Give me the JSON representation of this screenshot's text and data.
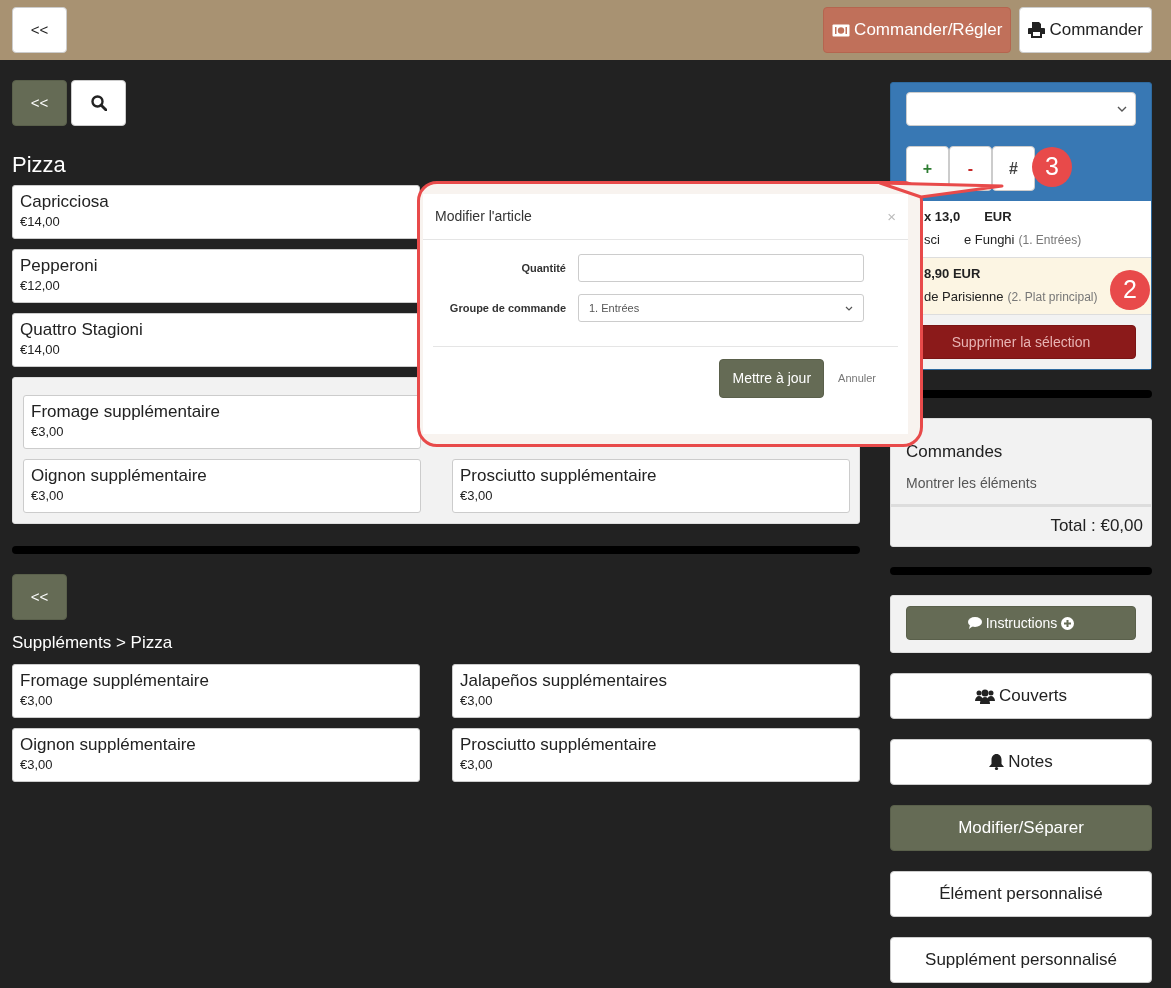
{
  "top_bar": {
    "back_button": "<<",
    "actions": [
      {
        "label": "Commander/Régler",
        "kind": "pay"
      },
      {
        "label": "Commander",
        "kind": "print"
      }
    ]
  },
  "menu": {
    "back_button": "<<",
    "section_title": "Pizza",
    "products": [
      {
        "name": "Capricciosa",
        "price": "€14,00"
      },
      {
        "name": "Pepperoni",
        "price": "€12,00"
      },
      {
        "name": "Quattro Stagioni",
        "price": "€14,00"
      }
    ],
    "supplement_columns": [
      [
        {
          "name": "Fromage supplémentaire",
          "price": "€3,00"
        },
        {
          "name": "Oignon supplémentaire",
          "price": "€3,00"
        }
      ],
      [
        {
          "name": "Prosciutto supplémentaire",
          "price": "€3,00"
        }
      ]
    ]
  },
  "supplements": {
    "back_button": "<<",
    "breadcrumb": "Suppléments > Pizza",
    "items": [
      {
        "name": "Fromage supplémentaire",
        "price": "€3,00"
      },
      {
        "name": "Jalapeños supplémentaires",
        "price": "€3,00"
      },
      {
        "name": "Oignon supplémentaire",
        "price": "€3,00"
      },
      {
        "name": "Prosciutto supplémentaire",
        "price": "€3,00"
      }
    ]
  },
  "order_panel": {
    "quantity_buttons": [
      {
        "label": "+",
        "kind": "plus"
      },
      {
        "label": "-",
        "kind": "minus"
      },
      {
        "label": "#",
        "kind": "hash"
      }
    ],
    "lines": [
      {
        "price_parts": [
          "x 13,0",
          "EUR"
        ],
        "name_parts": [
          "sci",
          "e Funghi"
        ],
        "group": "(1. Entrées)",
        "selected": false
      },
      {
        "price_parts": [
          "8,90 EUR"
        ],
        "name_parts": [
          "de Parisienne"
        ],
        "group": "(2. Plat principal)",
        "selected": true
      }
    ],
    "delete_button": {
      "label": "Supprimer la sélection",
      "disabled": true
    }
  },
  "orders_card": {
    "title": "Commandes",
    "link": "Montrer les éléments",
    "total": "Total : €0,00"
  },
  "instructions_button": "Instructions",
  "side_actions": [
    {
      "label": "Couverts",
      "kind": "covers"
    },
    {
      "label": "Notes",
      "kind": "notes"
    },
    {
      "label": "Modifier/Séparer",
      "kind": "split"
    },
    {
      "label": "Élément personnalisé",
      "kind": "plain"
    },
    {
      "label": "Supplément personnalisé",
      "kind": "plain"
    }
  ],
  "callout": {
    "title": "Modifier l'article",
    "close": "×",
    "fields": [
      {
        "label": "Quantité",
        "kind": "input"
      },
      {
        "label": "Groupe de commande",
        "kind": "select",
        "value": "1. Entrées"
      }
    ],
    "submit": "Mettre à jour",
    "cancel": "Annuler",
    "markers": [
      "3",
      "2"
    ]
  }
}
